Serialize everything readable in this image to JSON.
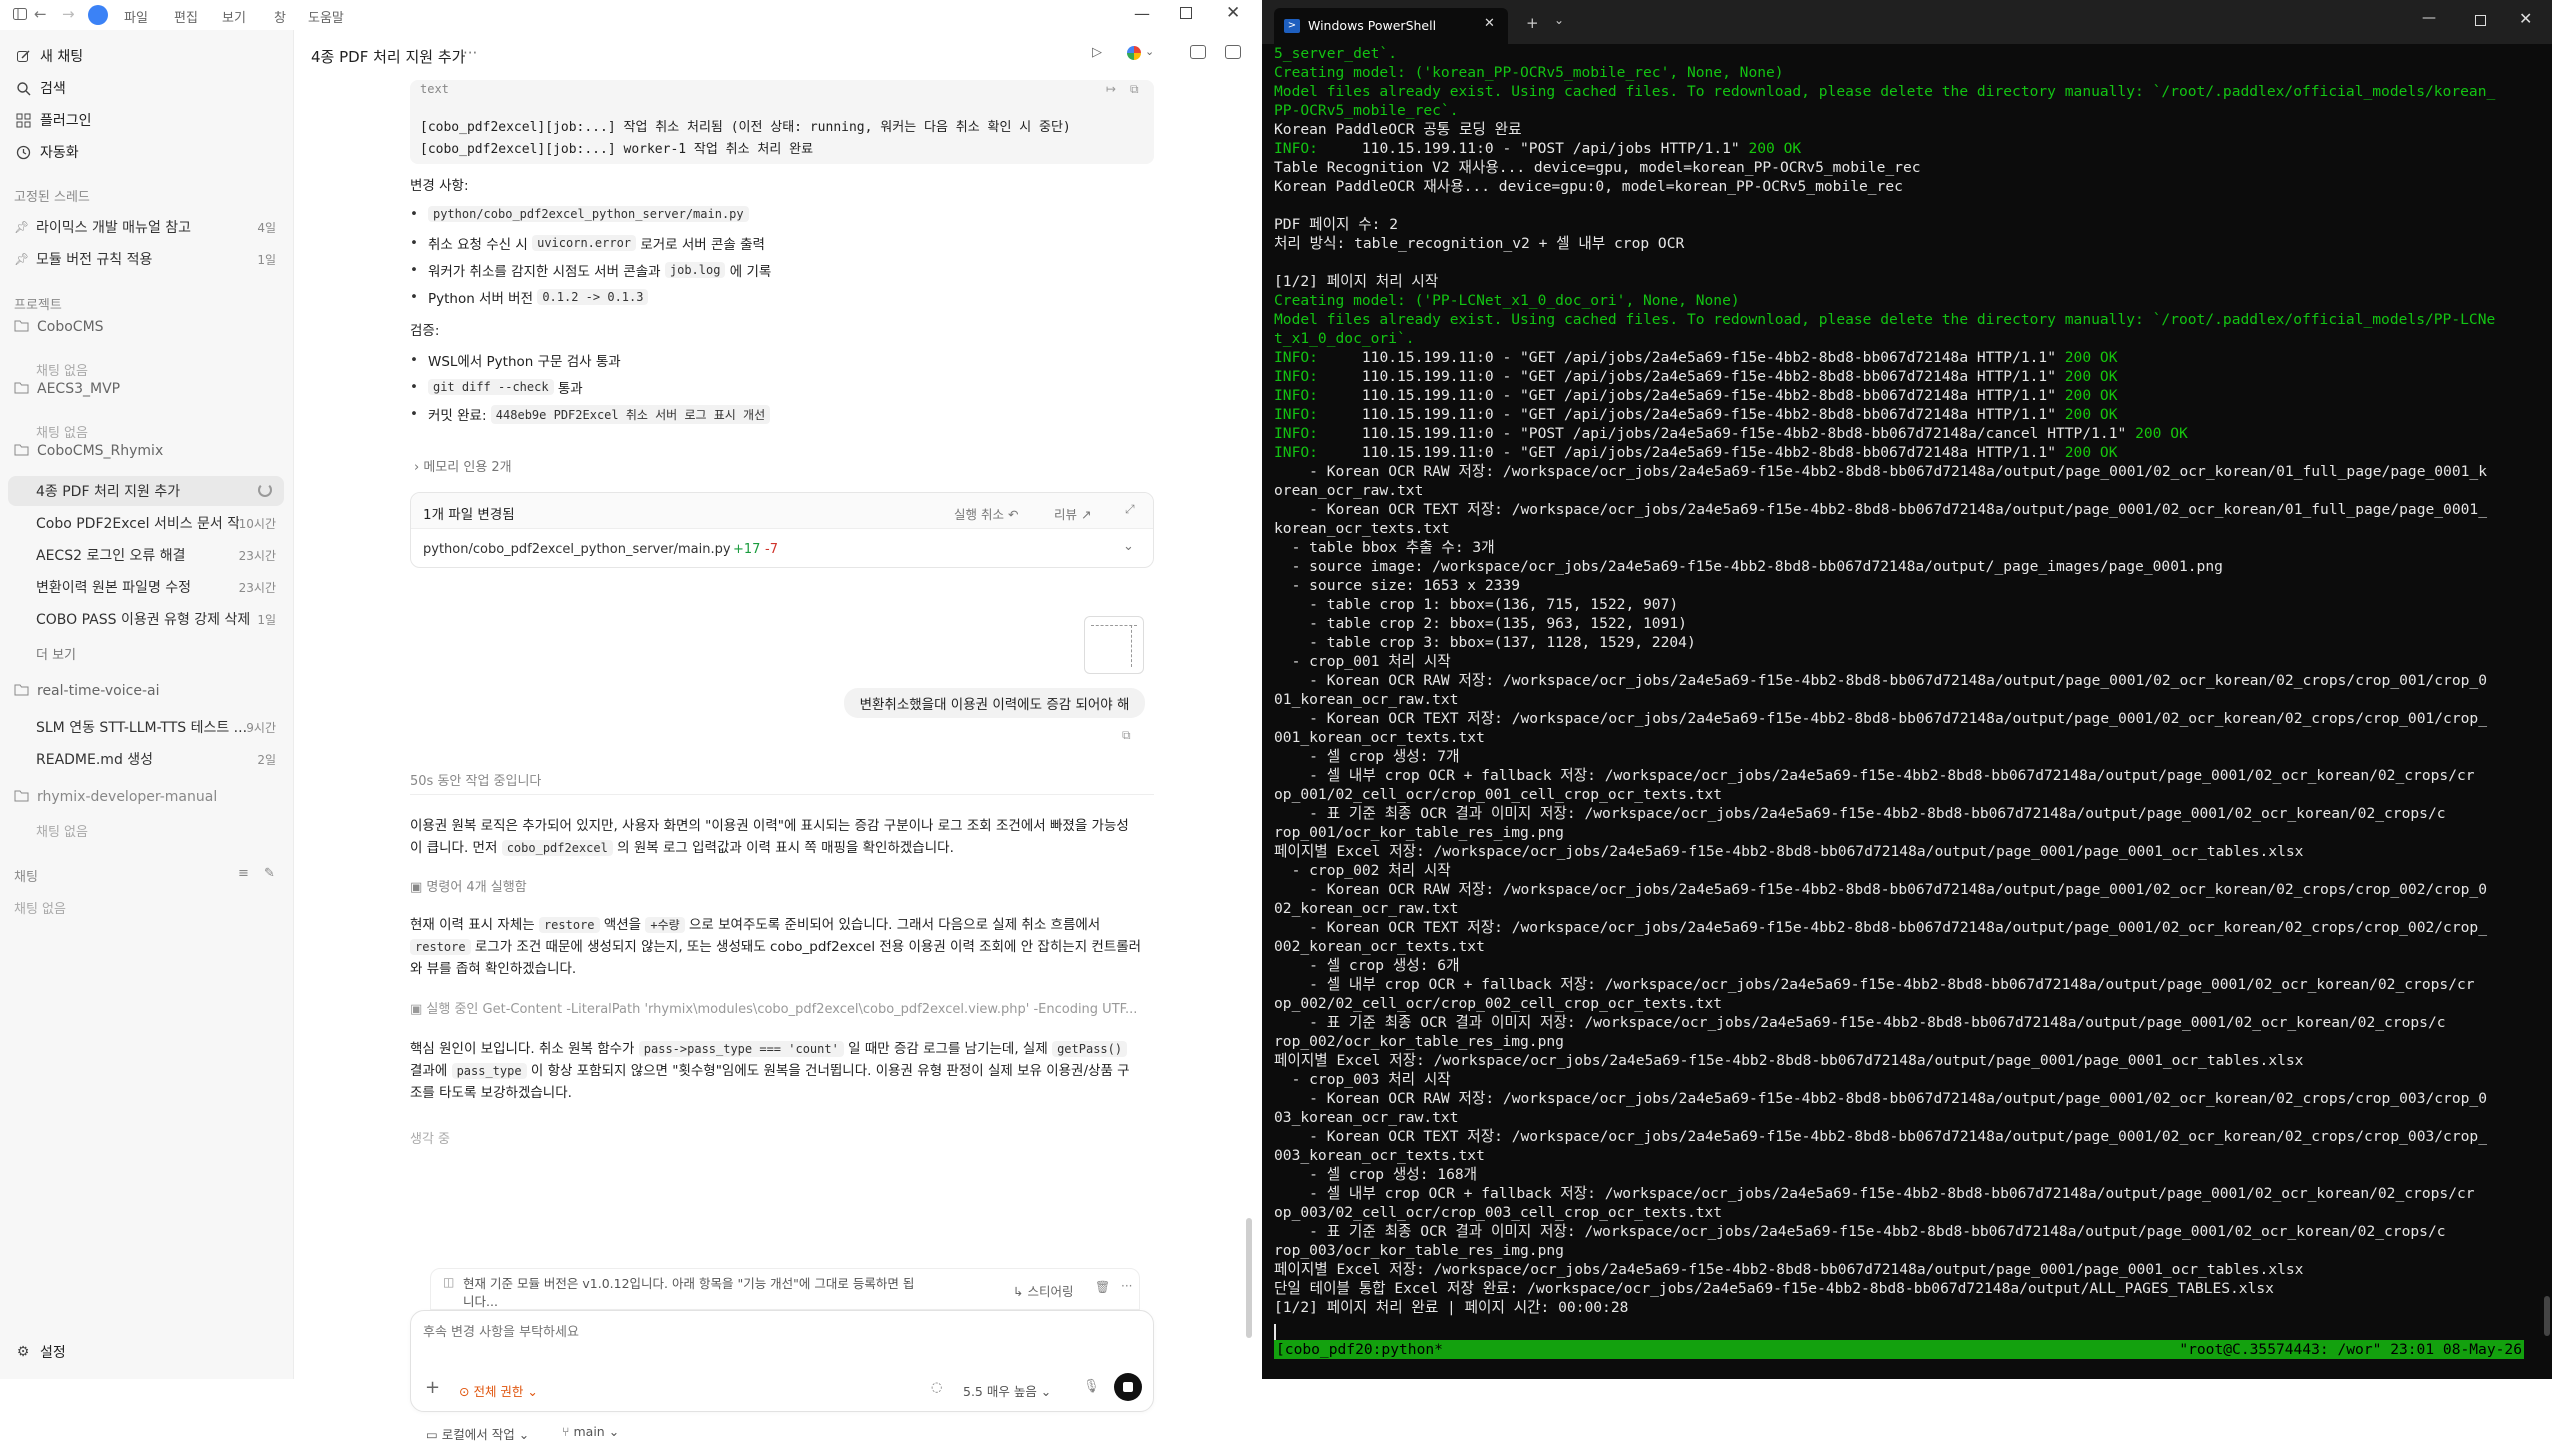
{
  "titlebar": {
    "menus": [
      "파일",
      "편집",
      "보기",
      "창",
      "도움말"
    ]
  },
  "sidebar": {
    "top_items": [
      {
        "label": "새 채팅",
        "icon": "edit-icon"
      },
      {
        "label": "검색",
        "icon": "search-icon"
      },
      {
        "label": "플러그인",
        "icon": "grid-icon"
      },
      {
        "label": "자동화",
        "icon": "clock-icon"
      }
    ],
    "pinned_label": "고정된 스레드",
    "pinned": [
      {
        "label": "라이믹스 개발 매뉴얼 참고",
        "time": "4일"
      },
      {
        "label": "모듈 버전 규칙 적용",
        "time": "1일"
      }
    ],
    "projects_label": "프로젝트",
    "projects": [
      {
        "name": "CoboCMS",
        "empty": "채팅 없음"
      },
      {
        "name": "AECS3_MVP",
        "empty": "채팅 없음"
      },
      {
        "name": "CoboCMS_Rhymix",
        "threads": [
          {
            "label": "4종 PDF 처리 지원 추가",
            "time": ""
          },
          {
            "label": "Cobo PDF2Excel 서비스 문서 작성",
            "time": "10시간"
          },
          {
            "label": "AECS2 로그인 오류 해결",
            "time": "23시간"
          },
          {
            "label": "변환이력 원본 파일명 수정",
            "time": "23시간"
          },
          {
            "label": "COBO PASS 이용권 유형 강제 삭제",
            "time": "1일"
          }
        ],
        "more": "더 보기"
      },
      {
        "name": "real-time-voice-ai",
        "threads": [
          {
            "label": "SLM 연동 STT-LLM-TTS 테스트 ...",
            "time": "9시간"
          },
          {
            "label": "README.md 생성",
            "time": "2일"
          }
        ]
      },
      {
        "name": "rhymix-developer-manual",
        "empty": "채팅 없음"
      }
    ],
    "chat_label": "채팅",
    "chat_empty": "채팅 없음",
    "settings": "설정"
  },
  "header": {
    "title": "4종 PDF 처리 지원 추가",
    "more": "···"
  },
  "convo": {
    "code_lang": "text",
    "code_lines": [
      "[cobo_pdf2excel][job:...] 작업 취소 처리됨 (이전 상태: running, 워커는 다음 취소 확인 시 중단)",
      "[cobo_pdf2excel][job:...] worker-1 작업 취소 처리 완료"
    ],
    "changes_title": "변경 사항:",
    "b1": "python/cobo_pdf2excel_python_server/main.py",
    "b2a": "취소 요청 수신 시",
    "b2b": "uvicorn.error",
    "b2c": "로거로 서버 콘솔 출력",
    "b3a": "워커가 취소를 감지한 시점도 서버 콘솔과",
    "b3b": "job.log",
    "b3c": "에 기록",
    "b4a": "Python 서버 버전",
    "b4b": "0.1.2 -> 0.1.3",
    "verify_title": "검증:",
    "v1": "WSL에서 Python 구문 검사 통과",
    "v2a": "git diff --check",
    "v2b": "통과",
    "v3a": "커밋 완료:",
    "v3b": "448eb9e PDF2Excel 취소 서버 로그 표시 개선",
    "memory": "메모리 인용 2개",
    "files_title": "1개 파일 변경됨",
    "undo": "실행 취소 ↶",
    "review": "리뷰 ↗",
    "file_path": "python/cobo_pdf2excel_python_server/main.py",
    "file_add": "+17",
    "file_del": "-7",
    "user_msg": "변환취소했을대 이용권 이력에도 증감 되어야 해",
    "working": "50s 동안 작업 중입니다",
    "p1": "이용권 원복 로직은 추가되어 있지만, 사용자 화면의 \"이용권 이력\"에 표시되는 증감 구분이나 로그 조회 조건에서 빠졌을 가능성",
    "p1b_a": "이 큽니다. 먼저",
    "p1b_b": "cobo_pdf2excel",
    "p1b_c": "의 원복 로그 입력값과 이력 표시 쪽 매핑을 확인하겠습니다.",
    "cmd1": "명령어 4개 실행함",
    "p2a_a": "현재 이력 표시 자체는",
    "p2a_b": "restore",
    "p2a_c": "액션을",
    "p2a_d": "+수량",
    "p2a_e": "으로 보여주도록 준비되어 있습니다. 그래서 다음으로 실제 취소 흐름에서",
    "p2b_a": "restore",
    "p2b_b": "로그가 조건 때문에 생성되지 않는지, 또는 생성돼도 cobo_pdf2excel 전용 이용권 이력 조회에 안 잡히는지 컨트롤러",
    "p2c": "와 뷰를 좁혀 확인하겠습니다.",
    "cmd2": "실행 중인 Get-Content -LiteralPath 'rhymix\\modules\\cobo_pdf2excel\\cobo_pdf2excel.view.php' -Encoding UTF...",
    "p3a_a": "핵심 원인이 보입니다. 취소 원복 함수가",
    "p3a_b": "pass->pass_type === 'count'",
    "p3a_c": "일 때만 증감 로그를 남기는데, 실제",
    "p3a_d": "getPass()",
    "p3b_a": "결과에",
    "p3b_b": "pass_type",
    "p3b_c": "이 항상 포함되지 않으면 \"횟수형\"임에도 원복을 건너뜁니다. 이용권 유형 판정이 실제 보유 이용권/상품 구",
    "p3c": "조를 타도록 보강하겠습니다.",
    "thinking": "생각 중",
    "queued_a": "현재 기준 모듈 버전은 v1.0.12입니다. 아래 항목을 \"기능 개선\"에 그대로 등록하면 됩",
    "queued_b": "니다...",
    "steer": "↳ 스티어링"
  },
  "composer": {
    "placeholder": "후속 변경 사항을 부탁하세요",
    "access": "전체 권한",
    "model": "5.5 매우 높음",
    "local": "로컬에서 작업",
    "branch": "main"
  },
  "terminal": {
    "tab_title": "Windows PowerShell",
    "status_left": "[cobo_pdf20:python*",
    "status_right": "\"root@C.35574443: /wor\" 23:01 08-May-26",
    "lines": [
      {
        "c": "green",
        "t": "5_server_det`."
      },
      {
        "c": "green",
        "t": "Creating model: ('korean_PP-OCRv5_mobile_rec', None, None)"
      },
      {
        "c": "green",
        "t": "Model files already exist. Using cached files. To redownload, please delete the directory manually: `/root/.paddlex/official_models/korean_"
      },
      {
        "c": "green",
        "t": "PP-OCRv5_mobile_rec`."
      },
      {
        "c": "w",
        "t": "Korean PaddleOCR 공통 로딩 완료"
      },
      {
        "c": "info",
        "t": "     110.15.199.11:0 - \"POST /api/jobs HTTP/1.1\" ",
        "ok": "200 OK"
      },
      {
        "c": "w",
        "t": "Table Recognition V2 재사용... device=gpu, model=korean_PP-OCRv5_mobile_rec"
      },
      {
        "c": "w",
        "t": "Korean PaddleOCR 재사용... device=gpu:0, model=korean_PP-OCRv5_mobile_rec"
      },
      {
        "c": "w",
        "t": ""
      },
      {
        "c": "w",
        "t": "PDF 페이지 수: 2"
      },
      {
        "c": "w",
        "t": "처리 방식: table_recognition_v2 + 셀 내부 crop OCR"
      },
      {
        "c": "w",
        "t": ""
      },
      {
        "c": "w",
        "t": "[1/2] 페이지 처리 시작"
      },
      {
        "c": "green",
        "t": "Creating model: ('PP-LCNet_x1_0_doc_ori', None, None)"
      },
      {
        "c": "green",
        "t": "Model files already exist. Using cached files. To redownload, please delete the directory manually: `/root/.paddlex/official_models/PP-LCNe"
      },
      {
        "c": "green",
        "t": "t_x1_0_doc_ori`."
      },
      {
        "c": "info",
        "t": "     110.15.199.11:0 - \"GET /api/jobs/2a4e5a69-f15e-4bb2-8bd8-bb067d72148a HTTP/1.1\" ",
        "ok": "200 OK"
      },
      {
        "c": "info",
        "t": "     110.15.199.11:0 - \"GET /api/jobs/2a4e5a69-f15e-4bb2-8bd8-bb067d72148a HTTP/1.1\" ",
        "ok": "200 OK"
      },
      {
        "c": "info",
        "t": "     110.15.199.11:0 - \"GET /api/jobs/2a4e5a69-f15e-4bb2-8bd8-bb067d72148a HTTP/1.1\" ",
        "ok": "200 OK"
      },
      {
        "c": "info",
        "t": "     110.15.199.11:0 - \"GET /api/jobs/2a4e5a69-f15e-4bb2-8bd8-bb067d72148a HTTP/1.1\" ",
        "ok": "200 OK"
      },
      {
        "c": "info",
        "t": "     110.15.199.11:0 - \"POST /api/jobs/2a4e5a69-f15e-4bb2-8bd8-bb067d72148a/cancel HTTP/1.1\" ",
        "ok": "200 OK"
      },
      {
        "c": "info",
        "t": "     110.15.199.11:0 - \"GET /api/jobs/2a4e5a69-f15e-4bb2-8bd8-bb067d72148a HTTP/1.1\" ",
        "ok": "200 OK"
      },
      {
        "c": "w",
        "t": "    - Korean OCR RAW 저장: /workspace/ocr_jobs/2a4e5a69-f15e-4bb2-8bd8-bb067d72148a/output/page_0001/02_ocr_korean/01_full_page/page_0001_k"
      },
      {
        "c": "w",
        "t": "orean_ocr_raw.txt"
      },
      {
        "c": "w",
        "t": "    - Korean OCR TEXT 저장: /workspace/ocr_jobs/2a4e5a69-f15e-4bb2-8bd8-bb067d72148a/output/page_0001/02_ocr_korean/01_full_page/page_0001_"
      },
      {
        "c": "w",
        "t": "korean_ocr_texts.txt"
      },
      {
        "c": "w",
        "t": "  - table bbox 추출 수: 3개"
      },
      {
        "c": "w",
        "t": "  - source image: /workspace/ocr_jobs/2a4e5a69-f15e-4bb2-8bd8-bb067d72148a/output/_page_images/page_0001.png"
      },
      {
        "c": "w",
        "t": "  - source size: 1653 x 2339"
      },
      {
        "c": "w",
        "t": "    - table crop 1: bbox=(136, 715, 1522, 907)"
      },
      {
        "c": "w",
        "t": "    - table crop 2: bbox=(135, 963, 1522, 1091)"
      },
      {
        "c": "w",
        "t": "    - table crop 3: bbox=(137, 1128, 1529, 2204)"
      },
      {
        "c": "w",
        "t": "  - crop_001 처리 시작"
      },
      {
        "c": "w",
        "t": "    - Korean OCR RAW 저장: /workspace/ocr_jobs/2a4e5a69-f15e-4bb2-8bd8-bb067d72148a/output/page_0001/02_ocr_korean/02_crops/crop_001/crop_0"
      },
      {
        "c": "w",
        "t": "01_korean_ocr_raw.txt"
      },
      {
        "c": "w",
        "t": "    - Korean OCR TEXT 저장: /workspace/ocr_jobs/2a4e5a69-f15e-4bb2-8bd8-bb067d72148a/output/page_0001/02_ocr_korean/02_crops/crop_001/crop_"
      },
      {
        "c": "w",
        "t": "001_korean_ocr_texts.txt"
      },
      {
        "c": "w",
        "t": "    - 셀 crop 생성: 7개"
      },
      {
        "c": "w",
        "t": "    - 셀 내부 crop OCR + fallback 저장: /workspace/ocr_jobs/2a4e5a69-f15e-4bb2-8bd8-bb067d72148a/output/page_0001/02_ocr_korean/02_crops/cr"
      },
      {
        "c": "w",
        "t": "op_001/02_cell_ocr/crop_001_cell_crop_ocr_texts.txt"
      },
      {
        "c": "w",
        "t": "    - 표 기준 최종 OCR 결과 이미지 저장: /workspace/ocr_jobs/2a4e5a69-f15e-4bb2-8bd8-bb067d72148a/output/page_0001/02_ocr_korean/02_crops/c"
      },
      {
        "c": "w",
        "t": "rop_001/ocr_kor_table_res_img.png"
      },
      {
        "c": "w",
        "t": "페이지별 Excel 저장: /workspace/ocr_jobs/2a4e5a69-f15e-4bb2-8bd8-bb067d72148a/output/page_0001/page_0001_ocr_tables.xlsx"
      },
      {
        "c": "w",
        "t": "  - crop_002 처리 시작"
      },
      {
        "c": "w",
        "t": "    - Korean OCR RAW 저장: /workspace/ocr_jobs/2a4e5a69-f15e-4bb2-8bd8-bb067d72148a/output/page_0001/02_ocr_korean/02_crops/crop_002/crop_0"
      },
      {
        "c": "w",
        "t": "02_korean_ocr_raw.txt"
      },
      {
        "c": "w",
        "t": "    - Korean OCR TEXT 저장: /workspace/ocr_jobs/2a4e5a69-f15e-4bb2-8bd8-bb067d72148a/output/page_0001/02_ocr_korean/02_crops/crop_002/crop_"
      },
      {
        "c": "w",
        "t": "002_korean_ocr_texts.txt"
      },
      {
        "c": "w",
        "t": "    - 셀 crop 생성: 6개"
      },
      {
        "c": "w",
        "t": "    - 셀 내부 crop OCR + fallback 저장: /workspace/ocr_jobs/2a4e5a69-f15e-4bb2-8bd8-bb067d72148a/output/page_0001/02_ocr_korean/02_crops/cr"
      },
      {
        "c": "w",
        "t": "op_002/02_cell_ocr/crop_002_cell_crop_ocr_texts.txt"
      },
      {
        "c": "w",
        "t": "    - 표 기준 최종 OCR 결과 이미지 저장: /workspace/ocr_jobs/2a4e5a69-f15e-4bb2-8bd8-bb067d72148a/output/page_0001/02_ocr_korean/02_crops/c"
      },
      {
        "c": "w",
        "t": "rop_002/ocr_kor_table_res_img.png"
      },
      {
        "c": "w",
        "t": "페이지별 Excel 저장: /workspace/ocr_jobs/2a4e5a69-f15e-4bb2-8bd8-bb067d72148a/output/page_0001/page_0001_ocr_tables.xlsx"
      },
      {
        "c": "w",
        "t": "  - crop_003 처리 시작"
      },
      {
        "c": "w",
        "t": "    - Korean OCR RAW 저장: /workspace/ocr_jobs/2a4e5a69-f15e-4bb2-8bd8-bb067d72148a/output/page_0001/02_ocr_korean/02_crops/crop_003/crop_0"
      },
      {
        "c": "w",
        "t": "03_korean_ocr_raw.txt"
      },
      {
        "c": "w",
        "t": "    - Korean OCR TEXT 저장: /workspace/ocr_jobs/2a4e5a69-f15e-4bb2-8bd8-bb067d72148a/output/page_0001/02_ocr_korean/02_crops/crop_003/crop_"
      },
      {
        "c": "w",
        "t": "003_korean_ocr_texts.txt"
      },
      {
        "c": "w",
        "t": "    - 셀 crop 생성: 168개"
      },
      {
        "c": "w",
        "t": "    - 셀 내부 crop OCR + fallback 저장: /workspace/ocr_jobs/2a4e5a69-f15e-4bb2-8bd8-bb067d72148a/output/page_0001/02_ocr_korean/02_crops/cr"
      },
      {
        "c": "w",
        "t": "op_003/02_cell_ocr/crop_003_cell_crop_ocr_texts.txt"
      },
      {
        "c": "w",
        "t": "    - 표 기준 최종 OCR 결과 이미지 저장: /workspace/ocr_jobs/2a4e5a69-f15e-4bb2-8bd8-bb067d72148a/output/page_0001/02_ocr_korean/02_crops/c"
      },
      {
        "c": "w",
        "t": "rop_003/ocr_kor_table_res_img.png"
      },
      {
        "c": "w",
        "t": "페이지별 Excel 저장: /workspace/ocr_jobs/2a4e5a69-f15e-4bb2-8bd8-bb067d72148a/output/page_0001/page_0001_ocr_tables.xlsx"
      },
      {
        "c": "w",
        "t": "단일 테이블 통합 Excel 저장 완료: /workspace/ocr_jobs/2a4e5a69-f15e-4bb2-8bd8-bb067d72148a/output/ALL_PAGES_TABLES.xlsx"
      },
      {
        "c": "w",
        "t": "[1/2] 페이지 처리 완료 | 페이지 시간: 00:00:28"
      }
    ]
  }
}
